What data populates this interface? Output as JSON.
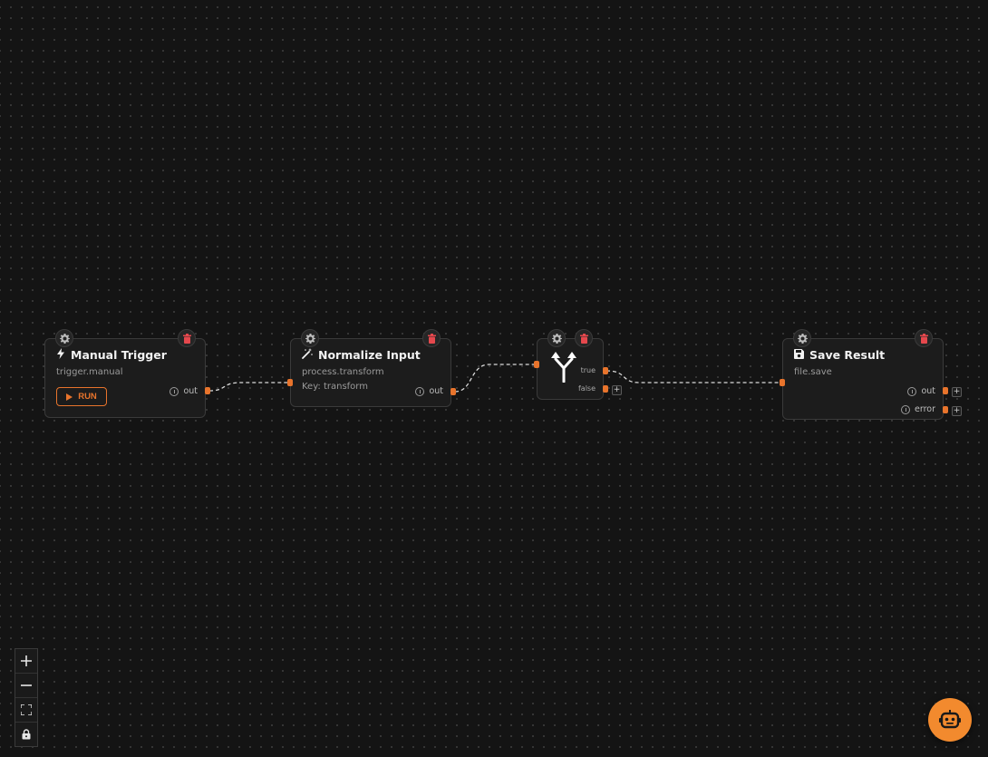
{
  "nodes": {
    "manual_trigger": {
      "title": "Manual Trigger",
      "subtitle": "trigger.manual",
      "run_label": "RUN",
      "output": "out"
    },
    "normalize_input": {
      "title": "Normalize Input",
      "subtitle": "process.transform",
      "key_line": "Key: transform",
      "output": "out"
    },
    "branch": {
      "output_true": "true",
      "output_false": "false"
    },
    "save_result": {
      "title": "Save Result",
      "subtitle": "file.save",
      "output_out": "out",
      "output_error": "error"
    }
  },
  "colors": {
    "accent": "#e8742c",
    "delete": "#e5484d",
    "canvas_bg": "#141414",
    "node_bg": "#1c1c1c",
    "fab": "#f28a2e"
  },
  "icons": {
    "node_settings": "gear-icon",
    "node_delete": "trash-icon",
    "trigger": "lightning-icon",
    "transform": "magic-wand-icon",
    "branch": "split-arrow-icon",
    "save": "floppy-disk-icon",
    "assistant": "robot-icon"
  },
  "controls": [
    "zoom-in",
    "zoom-out",
    "fit-view",
    "lock"
  ]
}
